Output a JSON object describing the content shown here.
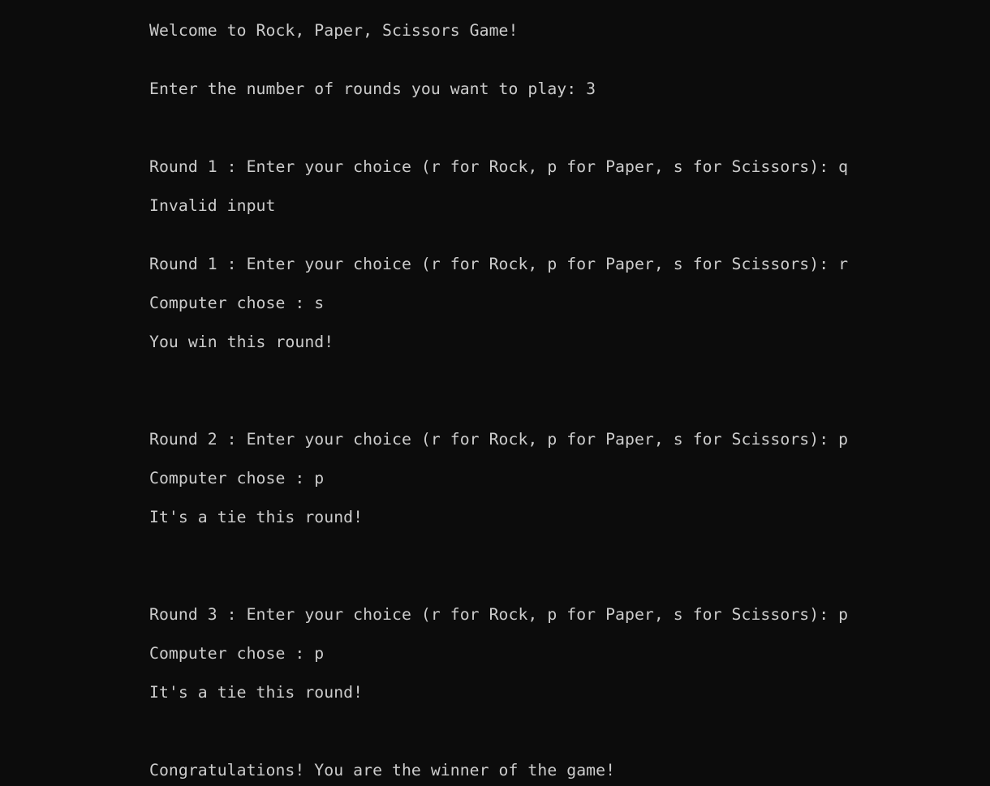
{
  "console": {
    "background_color": "#0c0c0c",
    "text_color": "#cccccc",
    "lines": [
      "Welcome to Rock, Paper, Scissors Game!",
      "Enter the number of rounds you want to play: 3",
      "Round 1 : Enter your choice (r for Rock, p for Paper, s for Scissors): q",
      "Invalid input",
      "Round 1 : Enter your choice (r for Rock, p for Paper, s for Scissors): r",
      "Computer chose : s",
      "You win this round!",
      "Round 2 : Enter your choice (r for Rock, p for Paper, s for Scissors): p",
      "Computer chose : p",
      "It's a tie this round!",
      "Round 3 : Enter your choice (r for Rock, p for Paper, s for Scissors): p",
      "Computer chose : p",
      "It's a tie this round!",
      "Congratulations! You are the winner of the game!"
    ]
  }
}
